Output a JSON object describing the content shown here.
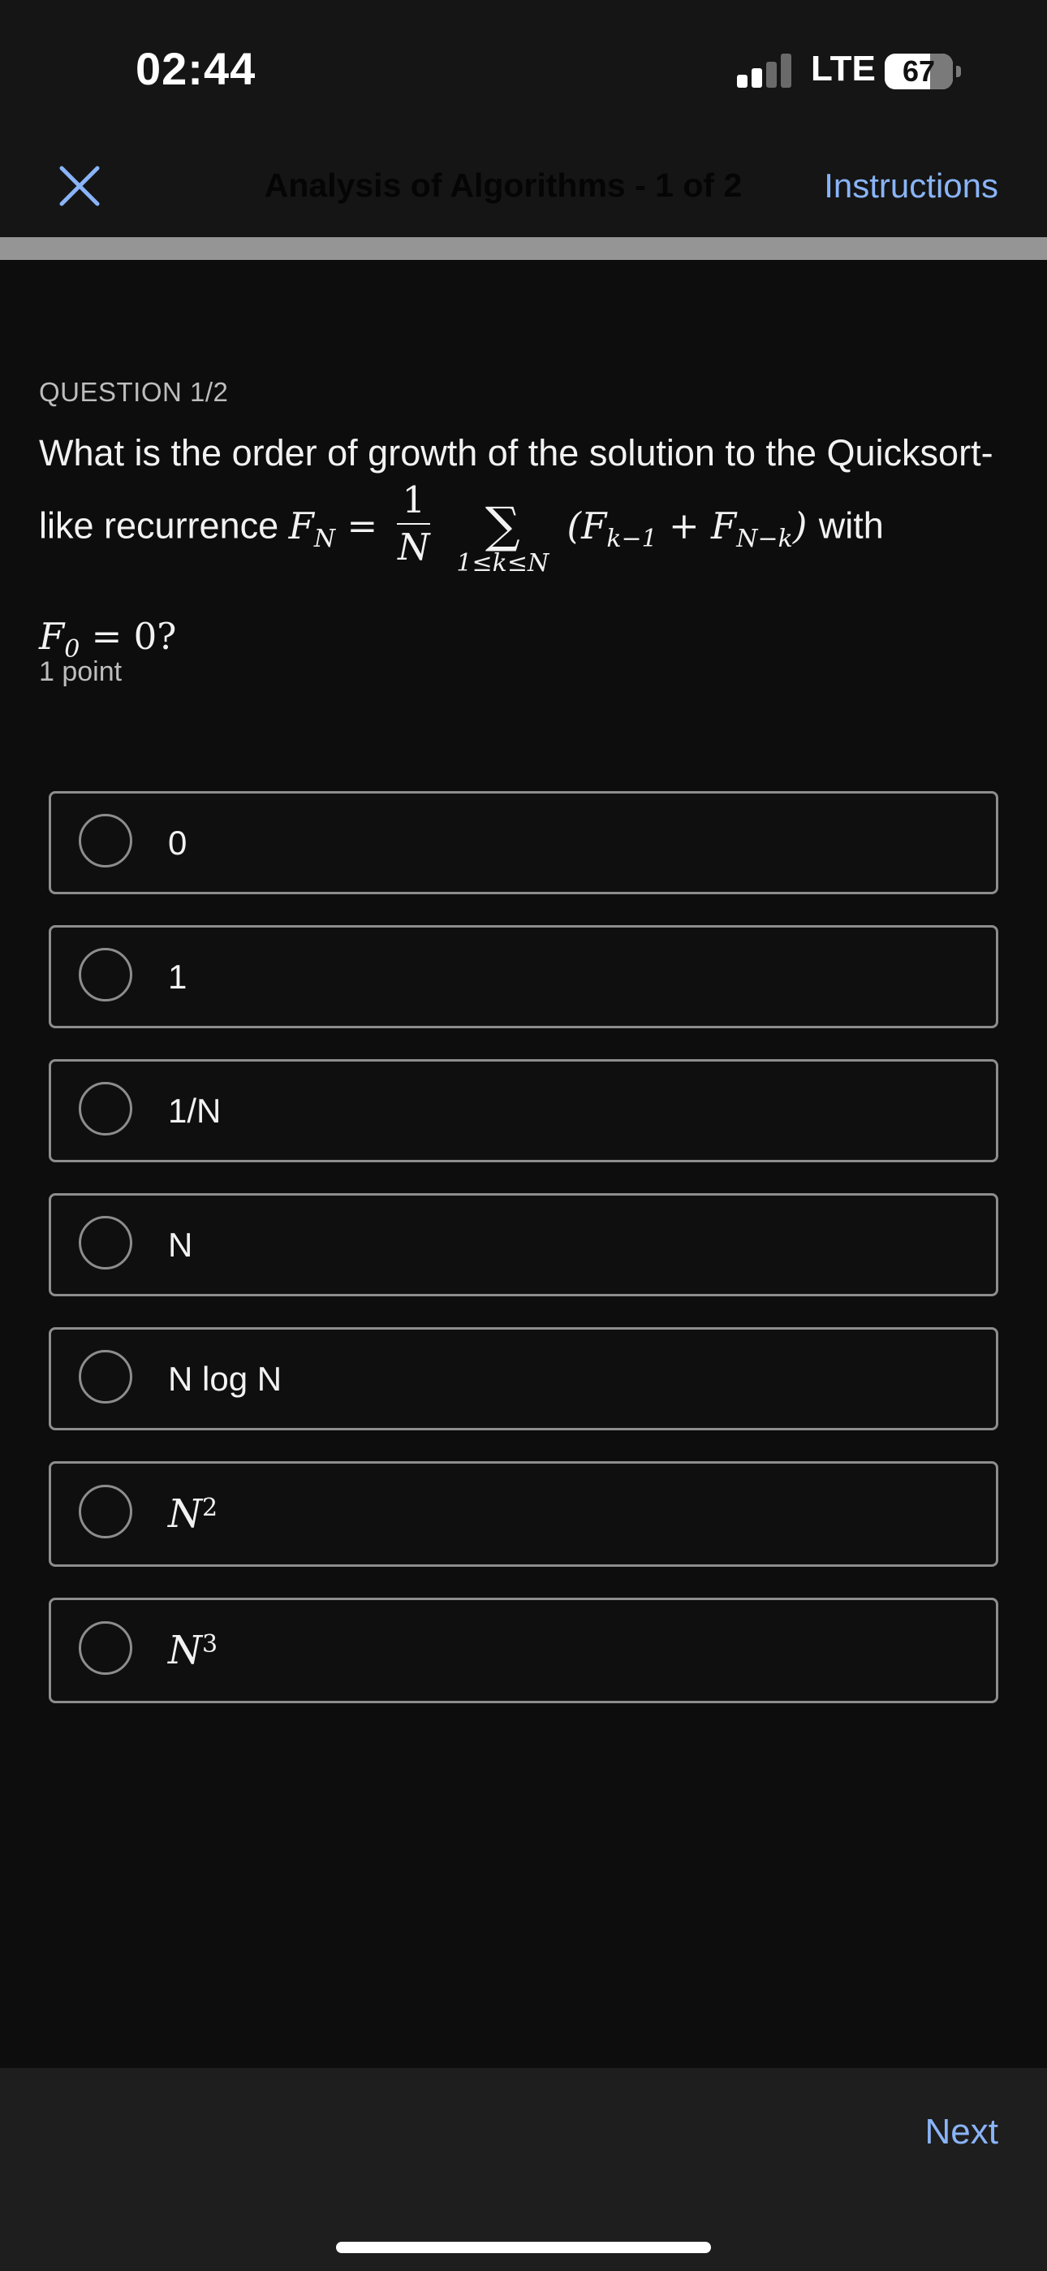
{
  "status_bar": {
    "time": "02:44",
    "network": "LTE",
    "battery_level": "67",
    "battery_fraction": 0.67,
    "signal_bars_active": 2,
    "signal_bars_total": 4
  },
  "nav": {
    "close_icon": "close-icon",
    "title": "Analysis of Algorithms - 1 of 2",
    "instructions_label": "Instructions",
    "accent_color": "#8ab4f8"
  },
  "question": {
    "label": "QUESTION 1/2",
    "text_intro": "What is the order of growth of the solution to the Quicksort-",
    "text_line2_prefix": "like recurrence",
    "formula": {
      "lhs": "F",
      "lhs_sub": "N",
      "eq": "=",
      "frac_num": "1",
      "frac_den": "N",
      "sum_symbol": "∑",
      "sum_limits": "1≤k≤N",
      "body_open": "(F",
      "body_sub1": "k−1",
      "body_plus": " + F",
      "body_sub2": "N−k",
      "body_close": ")"
    },
    "text_line2_suffix": "with",
    "condition": {
      "var": "F",
      "sub": "0",
      "rest": " = 0?"
    },
    "points": "1 point"
  },
  "options": [
    {
      "label": "0",
      "math": false
    },
    {
      "label": "1",
      "math": false
    },
    {
      "label": "1/N",
      "math": false
    },
    {
      "label": "N",
      "math": false
    },
    {
      "label": "N log N",
      "math": false
    },
    {
      "label": "N",
      "sup": "2",
      "math": true
    },
    {
      "label": "N",
      "sup": "3",
      "math": true
    }
  ],
  "footer": {
    "next_label": "Next"
  }
}
